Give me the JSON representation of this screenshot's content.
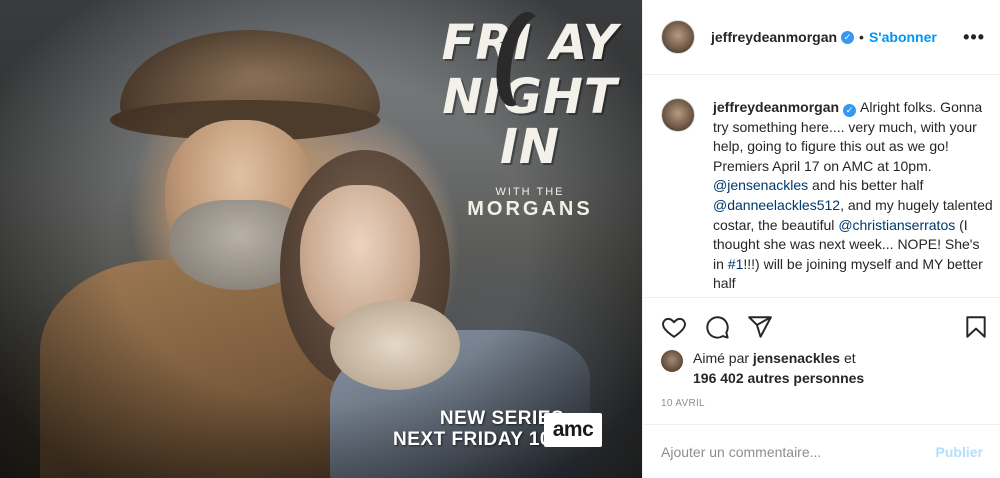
{
  "photo": {
    "title_line1": "FRI  AY",
    "title_line2": "NIGHT IN",
    "subtitle_small": "WITH THE",
    "subtitle_large": "MORGANS",
    "promo_line1": "NEW SERIES",
    "promo_line2": "NEXT FRIDAY 10P",
    "network_logo": "amc"
  },
  "header": {
    "username": "jeffreydeanmorgan",
    "separator": "•",
    "follow_label": "S'abonner",
    "more_label": "•••"
  },
  "caption": {
    "username": "jeffreydeanmorgan",
    "text_1": "Alright folks. Gonna try something here.... very much, with your help, going to figure this out as we go! Premiers April 17 on AMC at 10pm. ",
    "mention_1": "@jensenackles",
    "text_2": " and his better half ",
    "mention_2": "@danneelackles512",
    "text_3": ", and my hugely talented costar, the beautiful ",
    "mention_3": "@christianserratos",
    "text_4": " (I thought she was next week... NOPE! She's in ",
    "hashtag_1": "#1",
    "text_5": "!!!) will be joining myself and MY better half"
  },
  "likes": {
    "prefix": "Aimé par ",
    "user": "jensenackles",
    "middle": " et",
    "others": "196 402 autres personnes"
  },
  "timestamp": "10 AVRIL",
  "comment_bar": {
    "placeholder": "Ajouter un commentaire...",
    "publish_label": "Publier"
  },
  "colors": {
    "accent_blue": "#0095f6",
    "verified_blue": "#3897f0",
    "mention_blue": "#00376b",
    "publish_disabled": "#b2dffc",
    "muted_text": "#8e8e8e",
    "divider": "#efefef"
  },
  "icons": {
    "verified": "verified-badge-icon",
    "like": "heart-outline-icon",
    "comment": "speech-bubble-icon",
    "share": "paper-plane-icon",
    "save": "bookmark-outline-icon",
    "more": "ellipsis-icon"
  }
}
